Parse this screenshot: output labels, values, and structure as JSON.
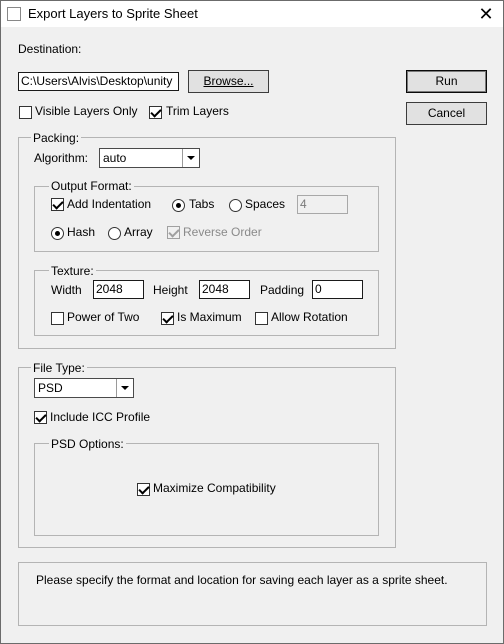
{
  "window": {
    "title": "Export Layers to Sprite Sheet",
    "close_glyph": "✕"
  },
  "destination": {
    "label": "Destination:",
    "path_value": "C:\\Users\\Alvis\\Desktop\\unity",
    "browse_label": "Browse..."
  },
  "buttons": {
    "run_label": "Run",
    "cancel_label": "Cancel"
  },
  "options": {
    "visible_layers_only": {
      "label": "Visible Layers Only",
      "checked": false
    },
    "trim_layers": {
      "label": "Trim Layers",
      "checked": true
    }
  },
  "packing": {
    "label": "Packing:",
    "algorithm_label": "Algorithm:",
    "algorithm_value": "auto",
    "output_format": {
      "label": "Output Format:",
      "add_indentation": {
        "label": "Add Indentation",
        "checked": true
      },
      "tabs_label": "Tabs",
      "spaces_label": "Spaces",
      "indent_selected": "Tabs",
      "spaces_value": "4",
      "hash_label": "Hash",
      "array_label": "Array",
      "structure_selected": "Hash",
      "reverse_order": {
        "label": "Reverse Order",
        "checked": true,
        "enabled": false
      }
    },
    "texture": {
      "label": "Texture:",
      "width_label": "Width",
      "width_value": "2048",
      "height_label": "Height",
      "height_value": "2048",
      "padding_label": "Padding",
      "padding_value": "0",
      "power_of_two": {
        "label": "Power of Two",
        "checked": false
      },
      "is_maximum": {
        "label": "Is Maximum",
        "checked": true
      },
      "allow_rotation": {
        "label": "Allow Rotation",
        "checked": false
      }
    }
  },
  "file_type": {
    "label": "File Type:",
    "value": "PSD",
    "include_icc": {
      "label": "Include ICC Profile",
      "checked": true
    },
    "psd_options": {
      "label": "PSD Options:",
      "maximize_compatibility": {
        "label": "Maximize Compatibility",
        "checked": true
      }
    }
  },
  "message": "Please specify the format and location for saving each layer as a sprite sheet."
}
